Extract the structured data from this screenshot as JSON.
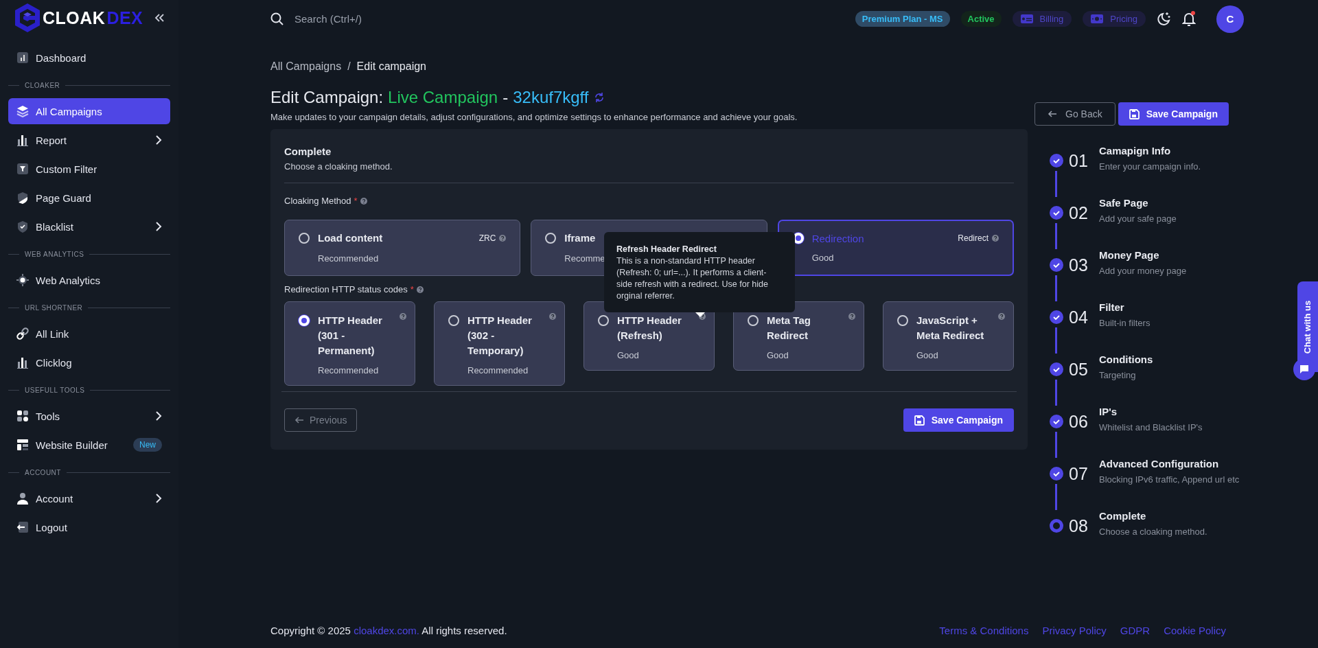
{
  "logo": {
    "text_a": "CLOAK",
    "text_b": "DEX"
  },
  "sidebar": {
    "items": [
      {
        "kind": "link",
        "label": "Dashboard",
        "selected": false,
        "submenu": false
      },
      {
        "kind": "section",
        "label": "CLOAKER"
      },
      {
        "kind": "link",
        "label": "All Campaigns",
        "selected": true,
        "submenu": false
      },
      {
        "kind": "link",
        "label": "Report",
        "selected": false,
        "submenu": true
      },
      {
        "kind": "link",
        "label": "Custom Filter",
        "selected": false,
        "submenu": false
      },
      {
        "kind": "link",
        "label": "Page Guard",
        "selected": false,
        "submenu": false
      },
      {
        "kind": "link",
        "label": "Blacklist",
        "selected": false,
        "submenu": true
      },
      {
        "kind": "section",
        "label": "WEB ANALYTICS"
      },
      {
        "kind": "link",
        "label": "Web Analytics",
        "selected": false,
        "submenu": false
      },
      {
        "kind": "section",
        "label": "URL SHORTNER"
      },
      {
        "kind": "link",
        "label": "All Link",
        "selected": false,
        "submenu": false
      },
      {
        "kind": "link",
        "label": "Clicklog",
        "selected": false,
        "submenu": false
      },
      {
        "kind": "section",
        "label": "USEFULL TOOLS"
      },
      {
        "kind": "link",
        "label": "Tools",
        "selected": false,
        "submenu": true
      },
      {
        "kind": "link",
        "label": "Website Builder",
        "selected": false,
        "submenu": false,
        "badge": "New"
      },
      {
        "kind": "section",
        "label": "ACCOUNT"
      },
      {
        "kind": "link",
        "label": "Account",
        "selected": false,
        "submenu": true
      },
      {
        "kind": "link",
        "label": "Logout",
        "selected": false,
        "submenu": false
      }
    ]
  },
  "topbar": {
    "search": {
      "placeholder": "Search (Ctrl+/)"
    },
    "badges": [
      {
        "kind": "plan",
        "label": "Premium Plan - MS"
      },
      {
        "kind": "status",
        "label": "Active"
      },
      {
        "kind": "billing",
        "label": "Billing"
      },
      {
        "kind": "pricing",
        "label": "Pricing"
      }
    ],
    "notification_dot": true,
    "avatar": "C"
  },
  "breadcrumb": [
    {
      "label": "All Campaigns",
      "current": false,
      "separator": "/"
    },
    {
      "label": "Edit campaign",
      "current": true
    }
  ],
  "header": {
    "title": "Edit Campaign:",
    "name": "Live Campaign",
    "dash": "-",
    "code": "32kuf7kgff",
    "description": "Make updates to your campaign details, adjust configurations, and optimize settings to enhance performance and achieve your goals."
  },
  "actions": {
    "back": "Go Back",
    "save": "Save Campaign"
  },
  "panel": {
    "title": "Complete",
    "subtitle": "Choose a cloaking method.",
    "method_label": "Cloaking Method",
    "method_required": "*",
    "methods": [
      {
        "title": "Load content",
        "note": "Recommended",
        "tag": "ZRC",
        "selected": false
      },
      {
        "title": "Iframe",
        "note": "Recomme",
        "selected": false
      },
      {
        "title": "Redirection",
        "note": "Good",
        "tag": "Redirect",
        "selected": true
      }
    ],
    "status_label": "Redirection HTTP status codes",
    "status_required": "*",
    "statuses": [
      {
        "title": "HTTP Header (301 - Permanent)",
        "note": "Recommended",
        "selected": true
      },
      {
        "title": "HTTP Header (302 - Temporary)",
        "note": "Recommended",
        "selected": false
      },
      {
        "title": "HTTP Header (Refresh)",
        "note": "Good",
        "selected": false
      },
      {
        "title": "Meta Tag Redirect",
        "note": "Good",
        "selected": false
      },
      {
        "title": "JavaScript + Meta Redirect",
        "note": "Good",
        "selected": false
      }
    ],
    "tooltip": {
      "title": "Refresh Header Redirect",
      "text": "This is a non-standard HTTP header (Refresh: 0; url=...). It performs a client-side refresh with a redirect. Use for hide orginal referrer."
    },
    "previous": {
      "label": "Previous",
      "disabled": true
    },
    "save": "Save Campaign"
  },
  "steps": [
    {
      "number": "01",
      "title": "Camapign Info",
      "subtitle": "Enter your campaign info.",
      "done": true
    },
    {
      "number": "02",
      "title": "Safe Page",
      "subtitle": "Add your safe page",
      "done": true
    },
    {
      "number": "03",
      "title": "Money Page",
      "subtitle": "Add your money page",
      "done": true
    },
    {
      "number": "04",
      "title": "Filter",
      "subtitle": "Built-in filters",
      "done": true
    },
    {
      "number": "05",
      "title": "Conditions",
      "subtitle": "Targeting",
      "done": true
    },
    {
      "number": "06",
      "title": "IP's",
      "subtitle": "Whitelist and Blacklist IP's",
      "done": true
    },
    {
      "number": "07",
      "title": "Advanced Configuration",
      "subtitle": "Blocking IPv6 traffic, Append url etc",
      "done": true
    },
    {
      "number": "08",
      "title": "Complete",
      "subtitle": "Choose a cloaking method.",
      "done": false
    }
  ],
  "chat": {
    "label": "Chat with us"
  },
  "footer": {
    "copyright": "Copyright © 2025",
    "site": "cloakdex.com.",
    "rights": "All rights reserved.",
    "links": [
      "Terms & Conditions",
      "Privacy Policy",
      "GDPR",
      "Cookie Policy"
    ]
  }
}
